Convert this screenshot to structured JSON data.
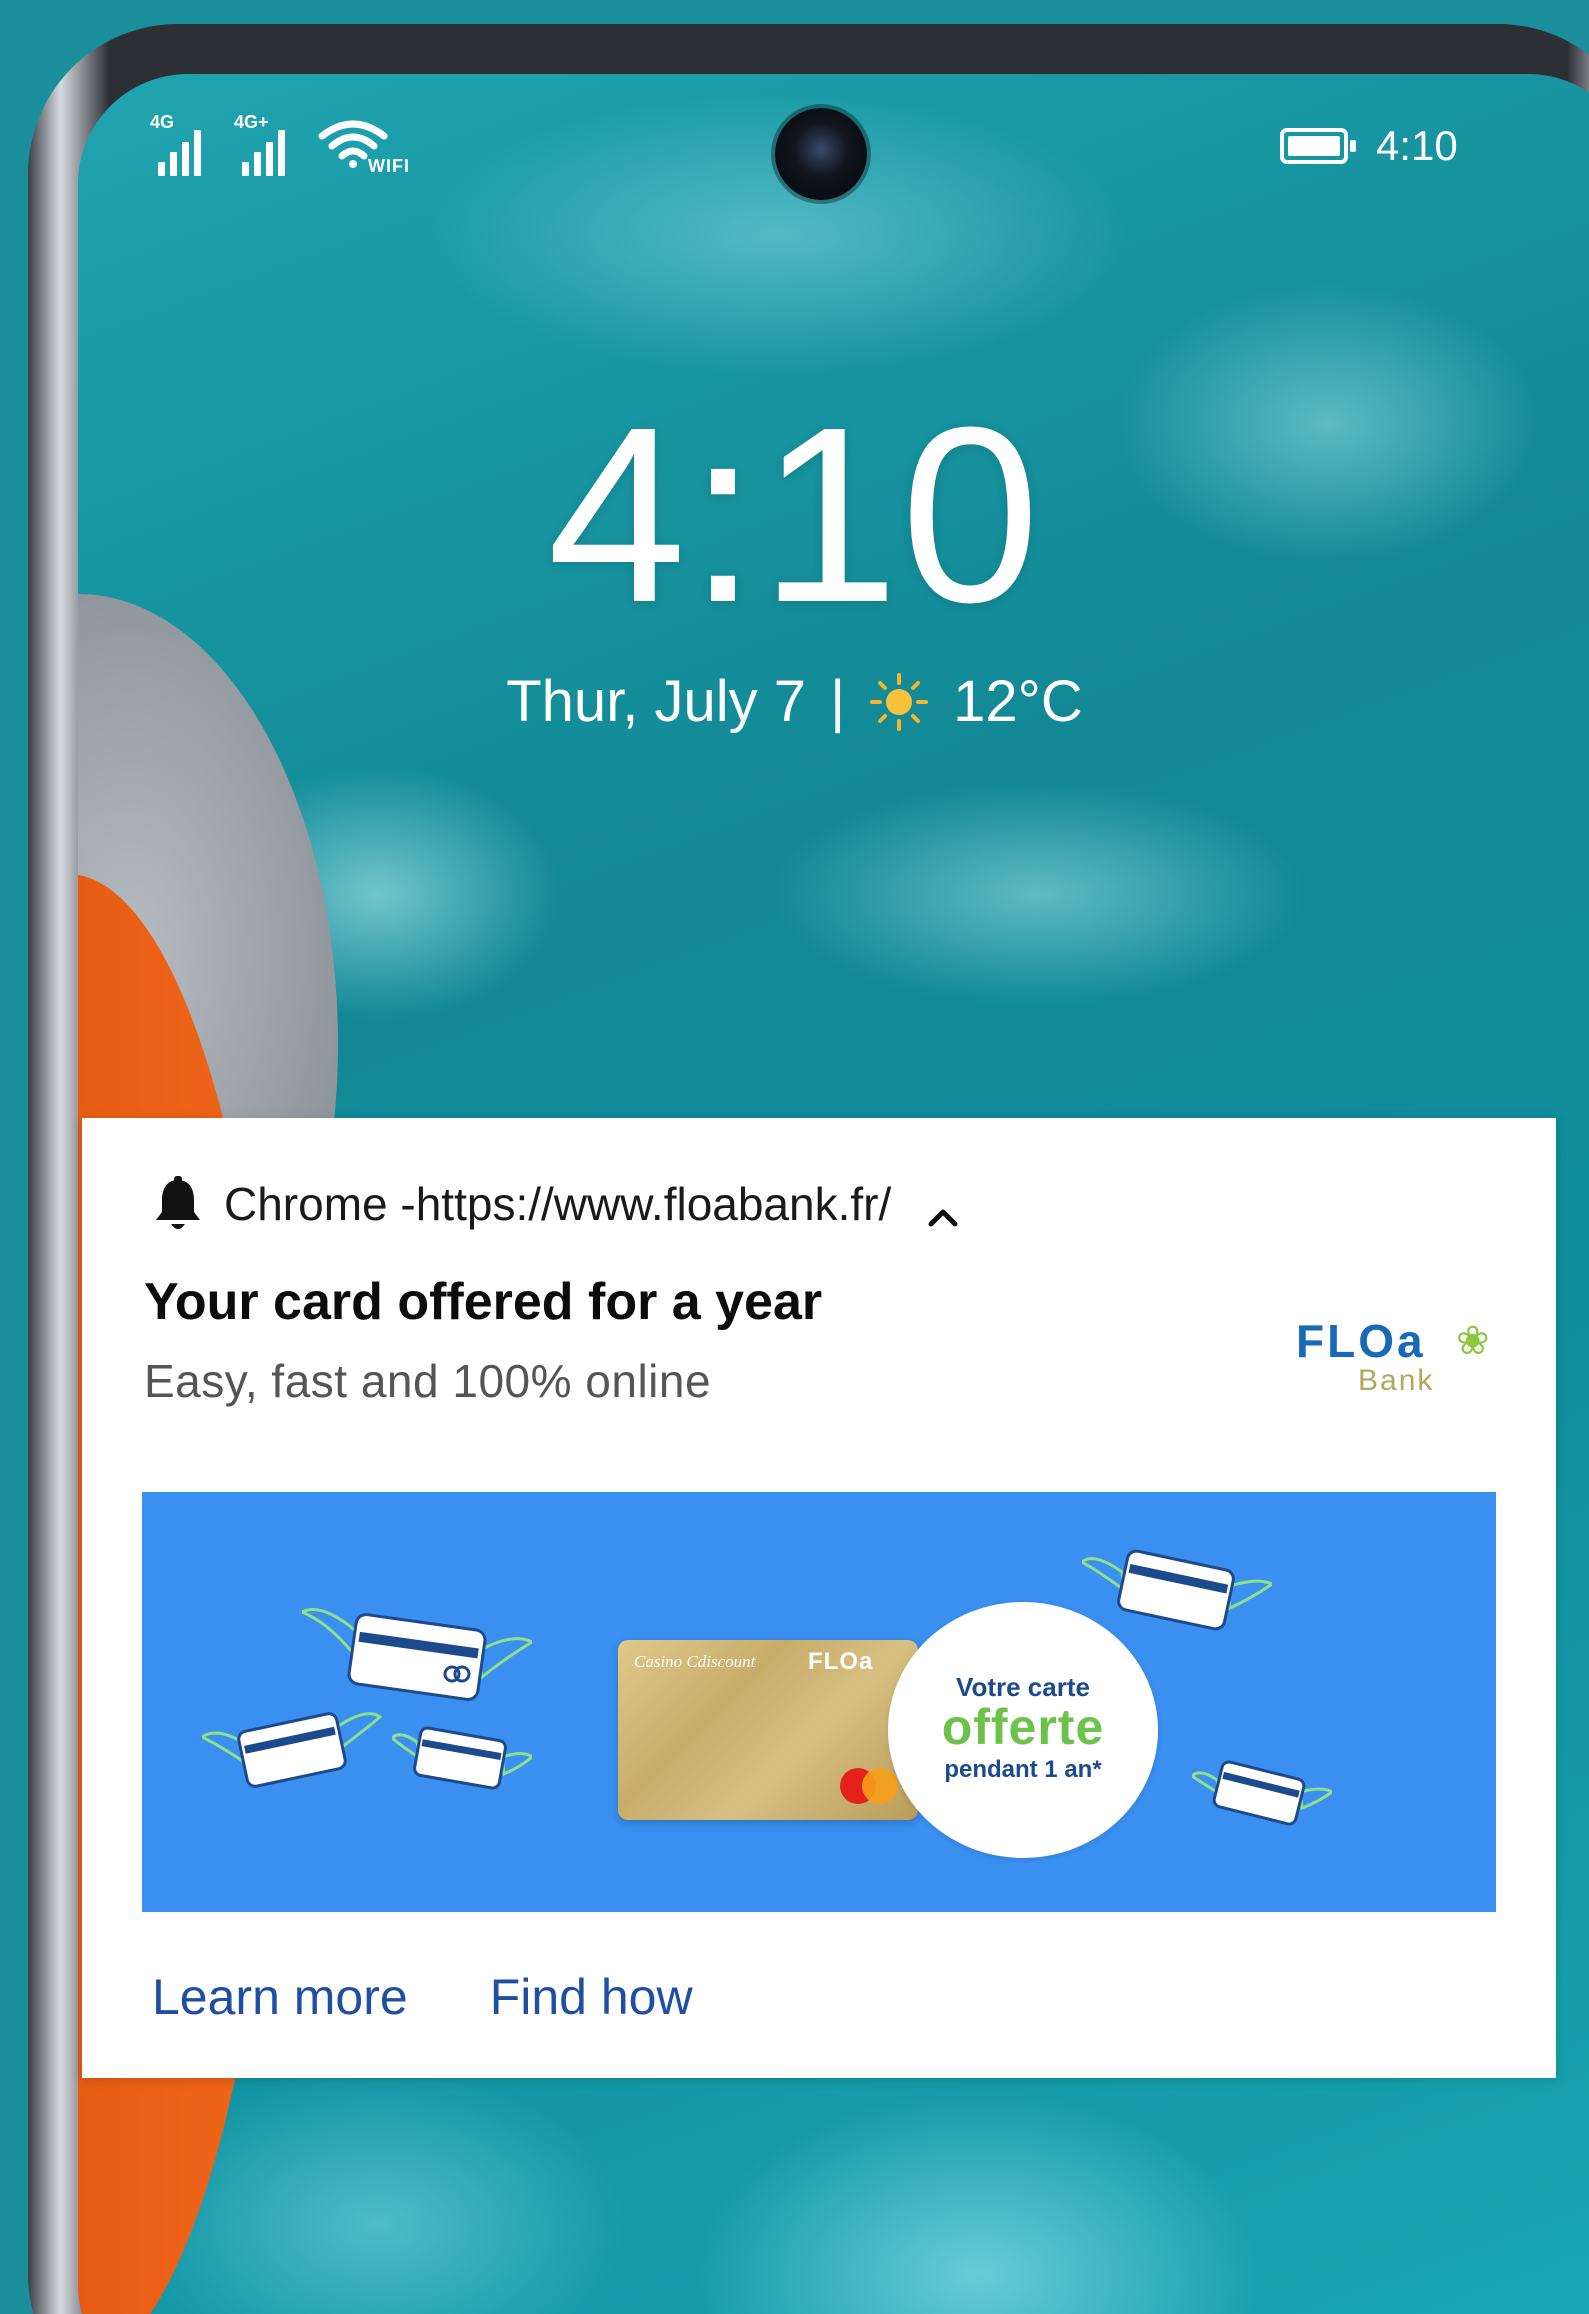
{
  "status_bar": {
    "sim1_tag": "4G",
    "sim2_tag": "4G+",
    "wifi_label": "WIFI",
    "time": "4:10",
    "icons": [
      "signal-icon",
      "signal-icon",
      "wifi-icon",
      "battery-icon"
    ]
  },
  "lock_screen": {
    "clock": "4:10",
    "date": "Thur, July 7",
    "separator": "|",
    "weather_icon": "sun-icon",
    "temperature": "12°C"
  },
  "notification": {
    "app": "Chrome -",
    "url": "https://www.floabank.fr/",
    "title": "Your card offered for a year",
    "body": "Easy, fast and 100% online",
    "logo": {
      "word": "FLOa",
      "sub": "Bank"
    },
    "banner": {
      "card_brand1": "Casino Cdiscount",
      "card_brand2": "FLOa",
      "offer_line1": "Votre carte",
      "offer_line2": "offerte",
      "offer_line3": "pendant 1 an*"
    },
    "actions": {
      "learn_more": "Learn more",
      "find_how": "Find how"
    }
  },
  "colors": {
    "accent_link": "#1f4fa3",
    "banner_bg": "#3a8ff0",
    "offer_green": "#6cc24a",
    "floa_blue": "#1a68b8",
    "floa_gold": "#b2a75c"
  }
}
